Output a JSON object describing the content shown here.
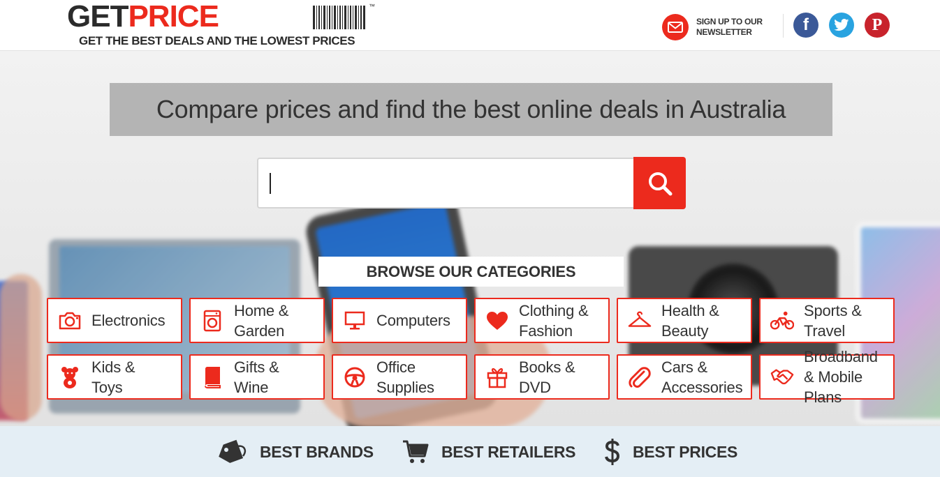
{
  "header": {
    "logo": {
      "get": "GET",
      "price": "PRICE",
      "tm": "™",
      "tagline": "GET THE BEST DEALS AND THE LOWEST PRICES"
    },
    "newsletter": {
      "line1": "SIGN UP TO OUR",
      "line2": "NEWSLETTER"
    },
    "social": [
      {
        "name": "facebook",
        "glyph": "f"
      },
      {
        "name": "twitter",
        "glyph": ""
      },
      {
        "name": "pinterest",
        "glyph": "P"
      }
    ]
  },
  "hero": {
    "title": "Compare prices and find the best online deals in Australia",
    "search": {
      "value": "",
      "placeholder": ""
    },
    "browse_heading": "BROWSE OUR CATEGORIES"
  },
  "categories": [
    {
      "label": "Electronics",
      "icon": "camera-icon"
    },
    {
      "label": "Home & Garden",
      "icon": "washing-machine-icon"
    },
    {
      "label": "Computers",
      "icon": "monitor-icon"
    },
    {
      "label": "Clothing & Fashion",
      "icon": "heart-icon"
    },
    {
      "label": "Health & Beauty",
      "icon": "hanger-icon"
    },
    {
      "label": "Sports & Travel",
      "icon": "bicycle-icon"
    },
    {
      "label": "Kids & Toys",
      "icon": "teddy-bear-icon"
    },
    {
      "label": "Gifts & Wine",
      "icon": "book-icon"
    },
    {
      "label": "Office Supplies",
      "icon": "steering-wheel-icon"
    },
    {
      "label": "Books & DVD",
      "icon": "gift-icon"
    },
    {
      "label": "Cars & Accessories",
      "icon": "paperclip-icon"
    },
    {
      "label": "Broadband & Mobile Plans",
      "icon": "handshake-icon"
    }
  ],
  "features": [
    {
      "label": "BEST BRANDS",
      "icon": "tag-icon"
    },
    {
      "label": "BEST RETAILERS",
      "icon": "cart-icon"
    },
    {
      "label": "BEST PRICES",
      "icon": "dollar-icon"
    }
  ],
  "colors": {
    "accent": "#ec2a1d",
    "dark": "#2b2b2b",
    "facebook": "#3b5998",
    "twitter": "#29a3e0",
    "pinterest": "#c8232c",
    "strip": "#e4eef5"
  }
}
